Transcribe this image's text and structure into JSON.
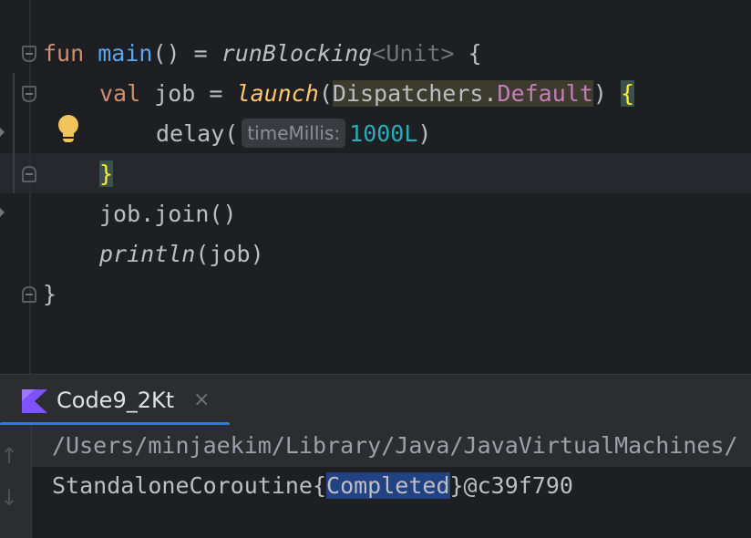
{
  "editor": {
    "line1": {
      "kw_fun": "fun",
      "fn_main": "main",
      "after_main": "() = ",
      "run_blocking": "runBlocking",
      "generic": "<Unit>",
      "open_brace": " {"
    },
    "line2": {
      "kw_val": "val",
      "job_decl": " job = ",
      "launch": "launch",
      "paren_open": "(",
      "dispatchers": "Dispatchers.",
      "default": "Default",
      "paren_close": ")",
      "space": " ",
      "brace": "{"
    },
    "line3": {
      "delay": "delay(",
      "hint": "timeMillis:",
      "value": "1000L",
      "close": ")"
    },
    "line4": {
      "brace": "}"
    },
    "line5": {
      "text": "job.join()"
    },
    "line6": {
      "println": "println",
      "args": "(job)"
    },
    "line7": {
      "brace": "}"
    }
  },
  "run_panel": {
    "tab_label": "Code9_2Kt",
    "tab_close": "×",
    "up_arrow": "↑",
    "down_arrow": "↓",
    "console_line1": "/Users/minjaekim/Library/Java/JavaVirtualMachines/",
    "console_line2_prefix": "StandaloneCoroutine{",
    "console_line2_selected": "Completed",
    "console_line2_suffix": "}@c39f790"
  },
  "colors": {
    "keyword": "#cf8e6d",
    "function_decl": "#56a8f5",
    "call": "#ffc66d",
    "property": "#c77dbb",
    "number": "#2aacb8",
    "selection": "#214283",
    "kotlin_purple": "#7f52ff"
  },
  "icons": [
    "fold-icon",
    "intention-bulb-icon",
    "kotlin-file-icon",
    "close-icon",
    "arrow-up-icon",
    "arrow-down-icon"
  ]
}
